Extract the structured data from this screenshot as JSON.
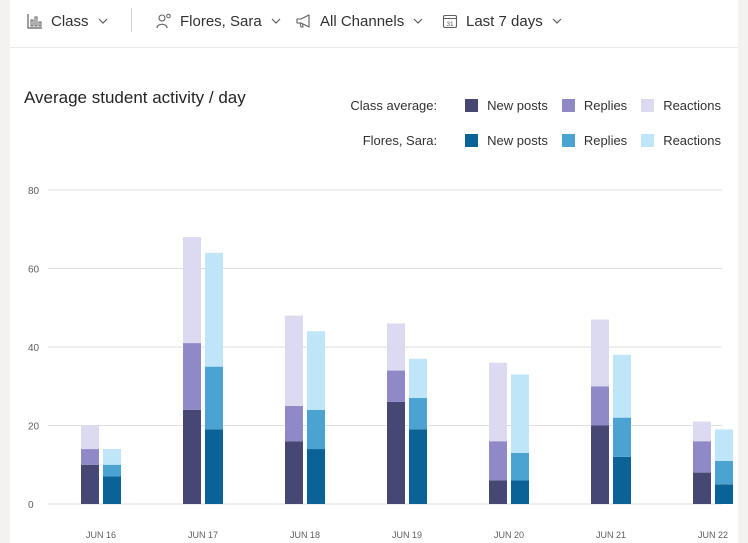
{
  "filters": {
    "class": {
      "label": "Class",
      "icon": "bar-chart-icon"
    },
    "student": {
      "label": "Flores, Sara",
      "icon": "person-icon"
    },
    "channels": {
      "label": "All Channels",
      "icon": "megaphone-icon"
    },
    "range": {
      "label": "Last 7 days",
      "icon": "calendar-icon"
    }
  },
  "chart_data": {
    "type": "bar",
    "title": "Average student activity / day",
    "xlabel": "",
    "ylabel": "",
    "ylim": [
      0,
      80
    ],
    "yticks": [
      0,
      20,
      40,
      60,
      80
    ],
    "grid": true,
    "legend_placement": "top-right",
    "stacked": true,
    "categories": [
      "JUN 16",
      "JUN 17",
      "JUN 18",
      "JUN 19",
      "JUN 20",
      "JUN 21",
      "JUN 22"
    ],
    "groups": [
      {
        "name": "Class average:",
        "series": [
          {
            "name": "New posts",
            "color": "#474773",
            "values": [
              10,
              24,
              16,
              26,
              6,
              20,
              8
            ]
          },
          {
            "name": "Replies",
            "color": "#8f8ac7",
            "values": [
              4,
              17,
              9,
              8,
              10,
              10,
              8
            ]
          },
          {
            "name": "Reactions",
            "color": "#dcdaf1",
            "values": [
              6,
              27,
              23,
              12,
              20,
              17,
              5
            ]
          }
        ]
      },
      {
        "name": "Flores, Sara:",
        "series": [
          {
            "name": "New posts",
            "color": "#0b6296",
            "values": [
              7,
              19,
              14,
              19,
              6,
              12,
              5
            ]
          },
          {
            "name": "Replies",
            "color": "#4aa3d1",
            "values": [
              3,
              16,
              10,
              8,
              7,
              10,
              6
            ]
          },
          {
            "name": "Reactions",
            "color": "#bfe5f9",
            "values": [
              4,
              29,
              20,
              10,
              20,
              16,
              8
            ]
          }
        ]
      }
    ]
  }
}
